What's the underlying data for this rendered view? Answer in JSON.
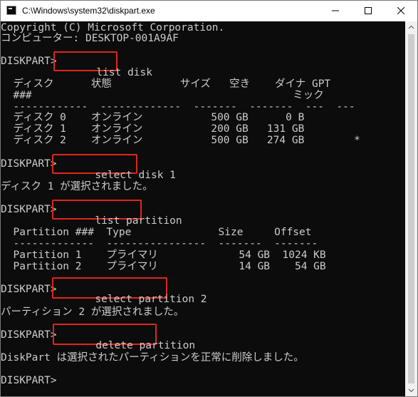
{
  "window": {
    "title": "C:\\Windows\\system32\\diskpart.exe",
    "icon": "console-app-icon"
  },
  "controls": {
    "minimize": "minimize-icon",
    "maximize": "maximize-icon",
    "close": "close-icon"
  },
  "console": {
    "banner": [
      "Copyright (C) Microsoft Corporation.",
      "コンピューター: DESKTOP-001A9AF"
    ],
    "prompt": "DISKPART> ",
    "commands": [
      "list disk",
      "select disk 1",
      "list partition",
      "select partition 2",
      "delete partition"
    ],
    "disk_table": {
      "header1": "  ディスク      状態           サイズ   空き    ダイナ GPT",
      "header2": "  ###                                          ミック",
      "separator": "  ------------  -------------  -------  -------  ---  ---",
      "rows": [
        "  ディスク 0    オンライン           500 GB      0 B",
        "  ディスク 1    オンライン           200 GB   131 GB",
        "  ディスク 2    オンライン           500 GB   274 GB        *"
      ]
    },
    "msg_disk_selected": "ディスク 1 が選択されました。",
    "partition_table": {
      "header": "  Partition ###  Type              Size     Offset",
      "separator": "  -------------  ----------------  -------  -------",
      "rows": [
        "  Partition 1    プライマリ             54 GB  1024 KB",
        "  Partition 2    プライマリ             14 GB    54 GB"
      ]
    },
    "msg_partition_selected": "パーティション 2 が選択されました。",
    "msg_deleted": "DiskPart は選択されたパーティションを正常に削除しました。",
    "final_prompt": "DISKPART> "
  },
  "colors": {
    "console_bg": "#0c0c0c",
    "console_text": "#cccccc",
    "highlight": "#e0261b"
  }
}
